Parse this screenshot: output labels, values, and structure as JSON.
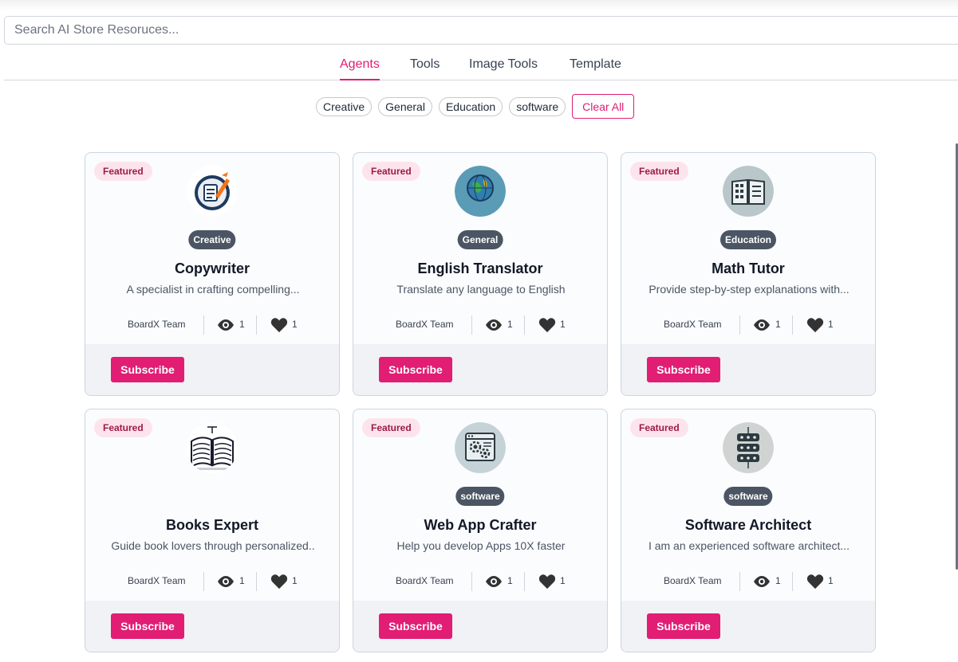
{
  "search": {
    "placeholder": "Search AI Store Resoruces..."
  },
  "tabs": [
    {
      "label": "Agents",
      "active": true
    },
    {
      "label": "Tools",
      "active": false
    },
    {
      "label": "Image Tools",
      "active": false
    },
    {
      "label": "Template",
      "active": false
    }
  ],
  "filters": {
    "chips": [
      "Creative",
      "General",
      "Education",
      "software"
    ],
    "clear_label": "Clear All"
  },
  "colors": {
    "accent": "#e11d74",
    "badge_bg": "#fde4ec",
    "category_bg": "#4b5563"
  },
  "cards": [
    {
      "featured": "Featured",
      "icon": "copywriter-icon",
      "category": "Creative",
      "title": "Copywriter",
      "description": "A specialist in crafting compelling...",
      "author": "BoardX Team",
      "views": "1",
      "likes": "1",
      "button": "Subscribe"
    },
    {
      "featured": "Featured",
      "icon": "globe-translator-icon",
      "category": "General",
      "title": "English Translator",
      "description": "Translate any language to English",
      "author": "BoardX Team",
      "views": "1",
      "likes": "1",
      "button": "Subscribe"
    },
    {
      "featured": "Featured",
      "icon": "math-book-icon",
      "category": "Education",
      "title": "Math Tutor",
      "description": "Provide step-by-step explanations with...",
      "author": "BoardX Team",
      "views": "1",
      "likes": "1",
      "button": "Subscribe"
    },
    {
      "featured": "Featured",
      "icon": "open-book-icon",
      "category": "",
      "title": "Books Expert",
      "description": "Guide book lovers through personalized..",
      "author": "BoardX Team",
      "views": "1",
      "likes": "1",
      "button": "Subscribe"
    },
    {
      "featured": "Featured",
      "icon": "web-gear-icon",
      "category": "software",
      "title": "Web App Crafter",
      "description": "Help you develop Apps 10X faster",
      "author": "BoardX Team",
      "views": "1",
      "likes": "1",
      "button": "Subscribe"
    },
    {
      "featured": "Featured",
      "icon": "server-architecture-icon",
      "category": "software",
      "title": "Software Architect",
      "description": "I am an experienced software architect...",
      "author": "BoardX Team",
      "views": "1",
      "likes": "1",
      "button": "Subscribe"
    }
  ]
}
